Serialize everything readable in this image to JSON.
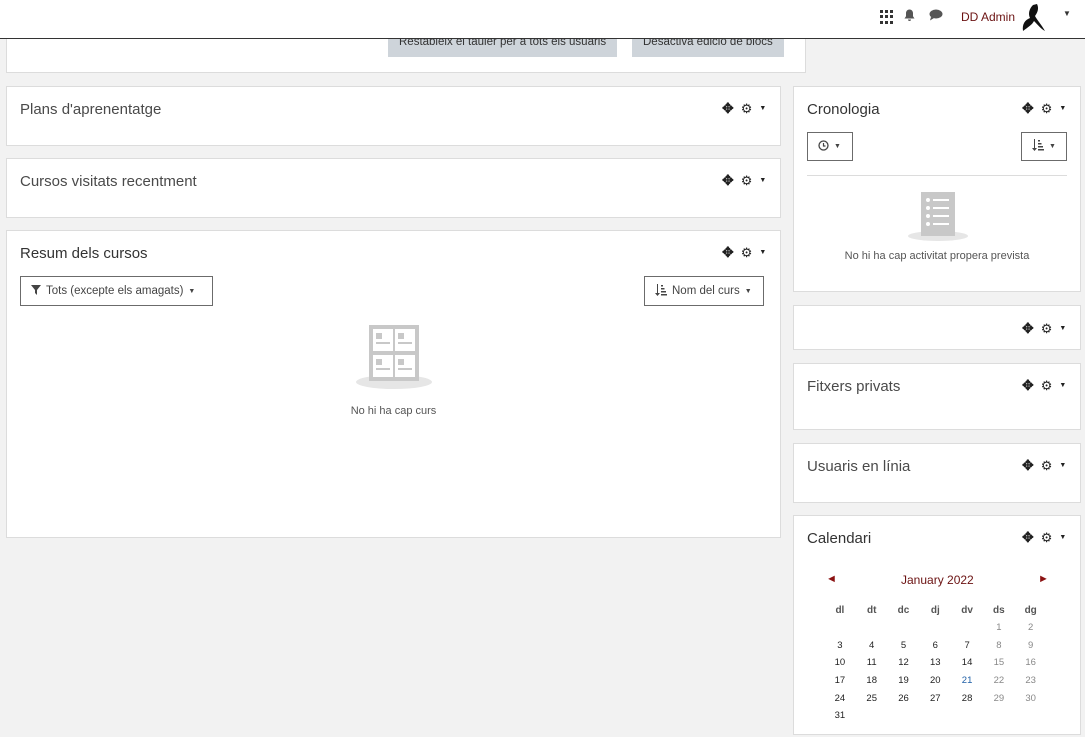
{
  "header": {
    "user_name": "DD Admin",
    "icons": [
      "apps-grid-icon",
      "bell-icon",
      "chat-icon",
      "avatar",
      "chevron-down-icon"
    ]
  },
  "top_actions": {
    "reset_label": "Restableix el tauler per a tots els usuaris",
    "disable_edit_label": "Desactiva edició de blocs"
  },
  "blocks": {
    "plans_title": "Plans d'aprenentatge",
    "recent_title": "Cursos visitats recentment",
    "overview": {
      "title": "Resum dels cursos",
      "filter_label": "Tots (excepte els amagats)",
      "sort_label": "Nom del curs",
      "empty_text": "No hi ha cap curs"
    },
    "timeline": {
      "title": "Cronologia",
      "empty_text": "No hi ha cap activitat propera prevista"
    },
    "files_title": "Fitxers privats",
    "online_title": "Usuaris en línia",
    "calendar": {
      "title": "Calendari",
      "prev": "◄",
      "next": "►",
      "month": "January 2022",
      "days": [
        "dl",
        "dt",
        "dc",
        "dj",
        "dv",
        "ds",
        "dg"
      ],
      "weeks": [
        [
          "",
          "",
          "",
          "",
          "",
          "1",
          "2"
        ],
        [
          "3",
          "4",
          "5",
          "6",
          "7",
          "8",
          "9"
        ],
        [
          "10",
          "11",
          "12",
          "13",
          "14",
          "15",
          "16"
        ],
        [
          "17",
          "18",
          "19",
          "20",
          "21",
          "22",
          "23"
        ],
        [
          "24",
          "25",
          "26",
          "27",
          "28",
          "29",
          "30"
        ],
        [
          "31",
          "",
          "",
          "",
          "",
          "",
          ""
        ]
      ],
      "today": "21"
    }
  },
  "colors": {
    "accent": "#6b1212",
    "today": "#1f5fa6",
    "button_grey": "#ced4da"
  }
}
